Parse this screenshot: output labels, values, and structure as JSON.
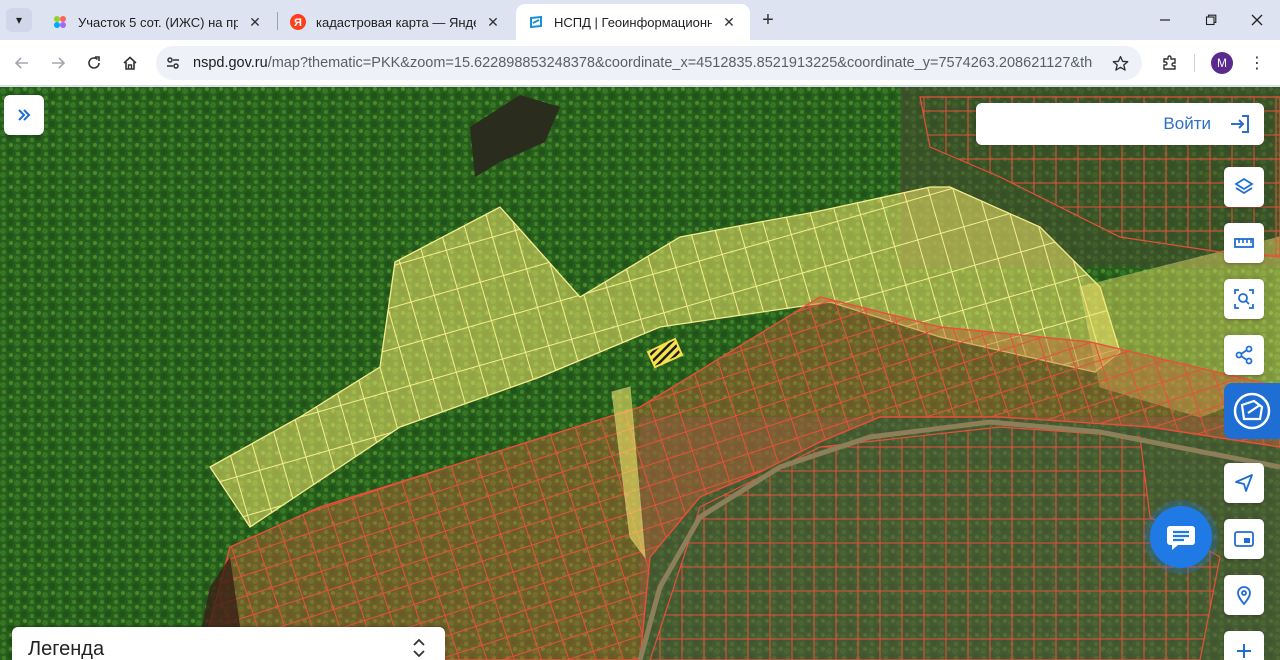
{
  "browser": {
    "tabs": [
      {
        "title": "Участок 5 сот. (ИЖС) на прода",
        "favicon": "avito-dots-icon",
        "active": false
      },
      {
        "title": "кадастровая карта — Яндекс: н",
        "favicon": "yandex-icon",
        "active": false
      },
      {
        "title": "НСПД | Геоинформационный",
        "favicon": "nspd-icon",
        "active": true
      }
    ],
    "url_host": "nspd.gov.ru",
    "url_rest": "/map?thematic=PKK&zoom=15.622898853248378&coordinate_x=4512835.8521913225&coordinate_y=7574263.208621127&theme...",
    "profile_initial": "M"
  },
  "map": {
    "login_label": "Войти",
    "legend_title": "Легенда",
    "colors": {
      "parcel_border": "#e8503a",
      "zone_fill": "#f3e56a",
      "selected": "#f7e24a",
      "accent": "#1f6ed4"
    }
  }
}
